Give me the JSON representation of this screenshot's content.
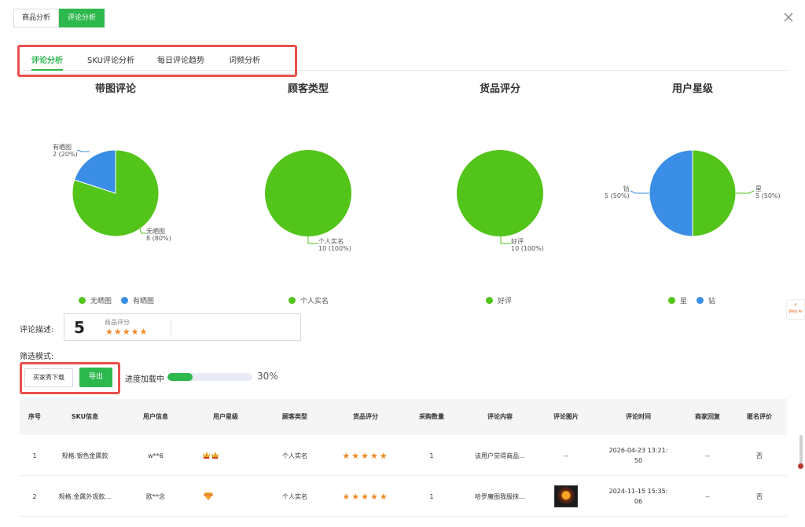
{
  "top_tabs": [
    {
      "label": "商品分析",
      "active": false
    },
    {
      "label": "评论分析",
      "active": true
    }
  ],
  "sub_tabs": [
    {
      "label": "评论分析",
      "active": true
    },
    {
      "label": "SKU评论分析",
      "active": false
    },
    {
      "label": "每日评论趋势",
      "active": false
    },
    {
      "label": "词频分析",
      "active": false
    }
  ],
  "colors": {
    "green": "#52c41a",
    "blue": "#3a8ee6",
    "accent": "#2db84d",
    "highlight": "#e8504d",
    "star": "#f08a24"
  },
  "chart_data": [
    {
      "type": "pie",
      "title": "带图评论",
      "slices": [
        {
          "label": "无晒图",
          "value": 8,
          "percent": "8 (80%)"
        },
        {
          "label": "有晒图",
          "value": 2,
          "percent": "2 (20%)"
        }
      ],
      "legend": [
        "无晒图",
        "有晒图"
      ]
    },
    {
      "type": "pie",
      "title": "顾客类型",
      "slices": [
        {
          "label": "个人实名",
          "value": 10,
          "percent": "10 (100%)"
        }
      ],
      "legend": [
        "个人实名"
      ]
    },
    {
      "type": "pie",
      "title": "货品评分",
      "slices": [
        {
          "label": "好评",
          "value": 10,
          "percent": "10 (100%)"
        }
      ],
      "legend": [
        "好评"
      ]
    },
    {
      "type": "pie",
      "title": "用户星级",
      "slices": [
        {
          "label": "星",
          "value": 5,
          "percent": "5 (50%)"
        },
        {
          "label": "钻",
          "value": 5,
          "percent": "5 (50%)"
        }
      ],
      "legend": [
        "星",
        "钻"
      ]
    }
  ],
  "summary": {
    "desc_label": "评论描述:",
    "score": "5",
    "score_label": "商品评分",
    "stars": 5,
    "filter_label": "筛选模式:"
  },
  "actions": {
    "download_label": "买家秀下载",
    "export_label": "导出",
    "progress_label": "进度加载中",
    "progress_value": 0.3,
    "progress_text": "30%"
  },
  "side_badge": "Web AI",
  "table": {
    "columns": [
      "序号",
      "SKU信息",
      "用户信息",
      "用户星级",
      "顾客类型",
      "货品评分",
      "采购数量",
      "评论内容",
      "评论图片",
      "评论时间",
      "商家回复",
      "匿名评价"
    ],
    "rows": [
      {
        "index": "1",
        "sku": "规格:银色金属款",
        "user": "w**6",
        "level_icon": "crown-star-icon",
        "customer_type": "个人实名",
        "rating": 5,
        "qty": "1",
        "content": "该用户觉得商品…",
        "image": "--",
        "time_line1": "2026-04-23 13:21:",
        "time_line2": "50",
        "reply": "--",
        "anonymous": "否"
      },
      {
        "index": "2",
        "sku": "规格:金属外观款…",
        "user": "欧**念",
        "level_icon": "diamond-icon",
        "customer_type": "个人实名",
        "rating": 5,
        "qty": "1",
        "content": "哈罗魔图我服抹…",
        "image": "thumbnail",
        "time_line1": "2024-11-15 15:35:",
        "time_line2": "06",
        "reply": "--",
        "anonymous": "否"
      }
    ]
  }
}
